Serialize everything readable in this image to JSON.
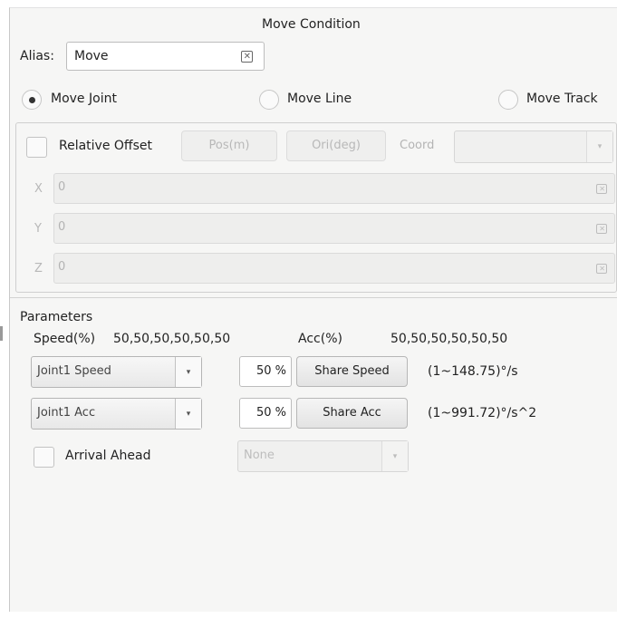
{
  "title": "Move Condition",
  "alias": {
    "label": "Alias:",
    "value": "Move"
  },
  "move_type": {
    "options": [
      {
        "label": "Move Joint",
        "selected": true
      },
      {
        "label": "Move Line",
        "selected": false
      },
      {
        "label": "Move Track",
        "selected": false
      }
    ]
  },
  "offset": {
    "relative_label": "Relative Offset",
    "relative_checked": false,
    "pos_button": "Pos(m)",
    "ori_button": "Ori(deg)",
    "coord_label": "Coord",
    "coord_value": "",
    "axes": [
      {
        "label": "X",
        "value": "0"
      },
      {
        "label": "Y",
        "value": "0"
      },
      {
        "label": "Z",
        "value": "0"
      }
    ]
  },
  "parameters": {
    "heading": "Parameters",
    "speed_label": "Speed(%)",
    "speed_values": "50,50,50,50,50,50",
    "acc_label": "Acc(%)",
    "acc_values": "50,50,50,50,50,50",
    "speed_row": {
      "select": "Joint1 Speed",
      "percent": "50 %",
      "button": "Share Speed",
      "range": "(1~148.75)°/s"
    },
    "acc_row": {
      "select": "Joint1 Acc",
      "percent": "50 %",
      "button": "Share Acc",
      "range": "(1~991.72)°/s^2"
    },
    "arrival_label": "Arrival Ahead",
    "arrival_checked": false,
    "arrival_select": "None"
  },
  "icons": {
    "clear": "clear-text-icon",
    "dropdown": "chevron-down-icon"
  },
  "colors": {
    "background": "#f6f6f5",
    "disabled_text": "#b4b4b4",
    "border": "#bdbdbd"
  }
}
